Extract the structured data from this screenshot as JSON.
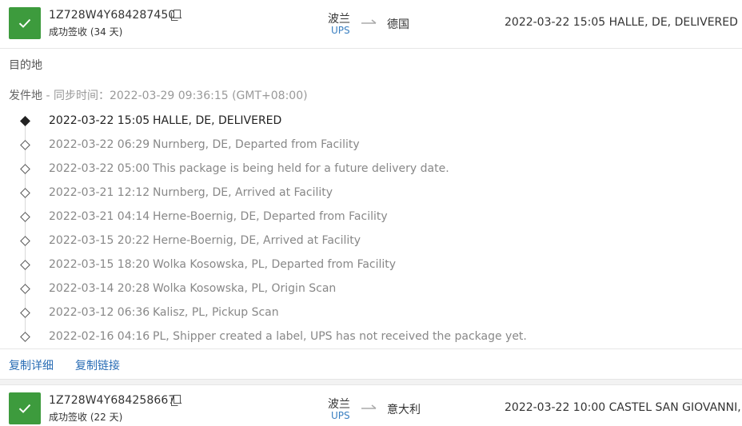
{
  "package1": {
    "tracking_number": "1Z728W4Y6842874501",
    "status": "成功签收 (34 天)",
    "origin_country": "波兰",
    "carrier": "UPS",
    "destination_country": "德国",
    "latest_event": "2022-03-22 15:05  HALLE, DE, DELIVERED",
    "destination_label": "目的地",
    "origin_label": "发件地",
    "sync_info": " - 同步时间：2022-03-29 09:36:15 (GMT+08:00)",
    "events": [
      {
        "time": "2022-03-22 15:05",
        "desc": "HALLE, DE, DELIVERED"
      },
      {
        "time": "2022-03-22 06:29",
        "desc": "Nurnberg, DE, Departed from Facility"
      },
      {
        "time": "2022-03-22 05:00",
        "desc": "This package is being held for a future delivery date."
      },
      {
        "time": "2022-03-21 12:12",
        "desc": "Nurnberg, DE, Arrived at Facility"
      },
      {
        "time": "2022-03-21 04:14",
        "desc": "Herne-Boernig, DE, Departed from Facility"
      },
      {
        "time": "2022-03-15 20:22",
        "desc": "Herne-Boernig, DE, Arrived at Facility"
      },
      {
        "time": "2022-03-15 18:20",
        "desc": "Wolka Kosowska, PL, Departed from Facility"
      },
      {
        "time": "2022-03-14 20:28",
        "desc": "Wolka Kosowska, PL, Origin Scan"
      },
      {
        "time": "2022-03-12 06:36",
        "desc": "Kalisz, PL, Pickup Scan"
      },
      {
        "time": "2022-02-16 04:16",
        "desc": "PL, Shipper created a label, UPS has not received the package yet."
      }
    ],
    "actions": {
      "copy_detail": "复制详细",
      "copy_link": "复制链接"
    }
  },
  "package2": {
    "tracking_number": "1Z728W4Y6842586671",
    "status": "成功签收 (22 天)",
    "origin_country": "波兰",
    "carrier": "UPS",
    "destination_country": "意大利",
    "latest_event": "2022-03-22 10:00  CASTEL SAN GIOVANNI, IT,"
  },
  "icons": {
    "status": "check-icon",
    "copy": "copy-icon",
    "route": "arrow-right-icon"
  },
  "colors": {
    "success": "#3d9b3d",
    "link": "#2a6db5",
    "carrier": "#3a7fc1"
  }
}
